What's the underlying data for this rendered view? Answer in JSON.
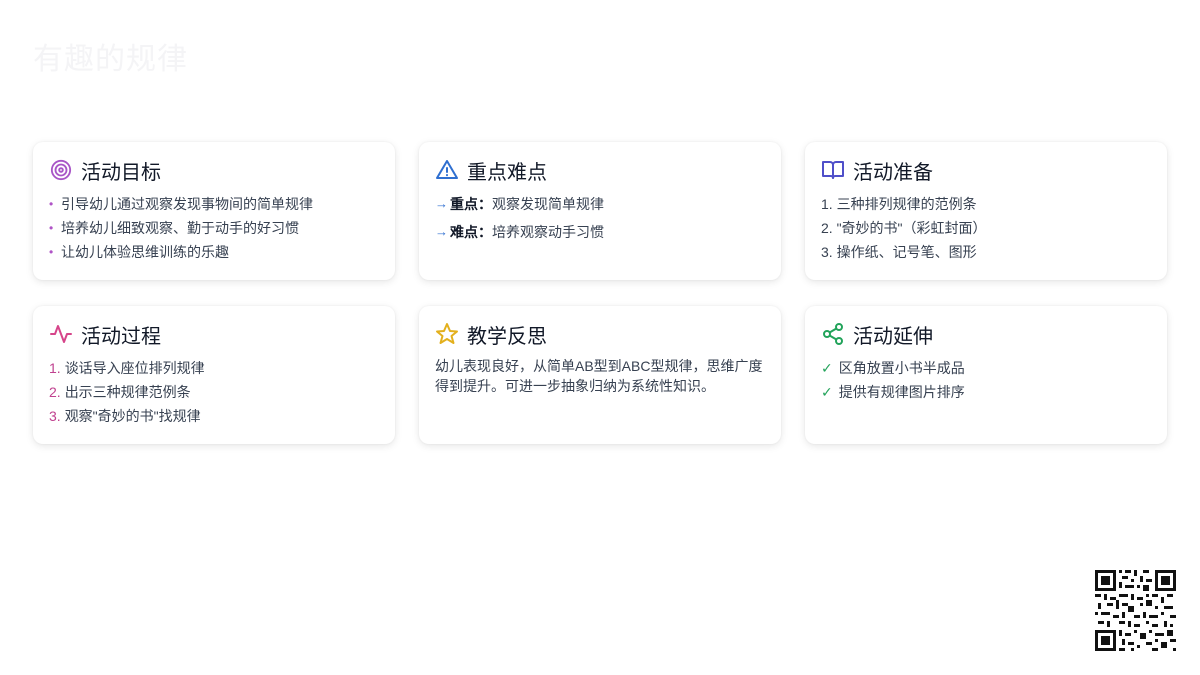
{
  "page": {
    "title": "有趣的规律"
  },
  "colors": {
    "goal_icon": "#a855c7",
    "key_icon": "#2f6fd0",
    "prep_icon": "#4f4fc9",
    "process_icon": "#d6458a",
    "reflect_icon": "#e3b01d",
    "extend_icon": "#22a35a"
  },
  "cards": {
    "goals": {
      "title": "活动目标",
      "icon": "target-icon",
      "items": [
        "引导幼儿通过观察发现事物间的简单规律",
        "培养幼儿细致观察、勤于动手的好习惯",
        "让幼儿体验思维训练的乐趣"
      ]
    },
    "key_points": {
      "title": "重点难点",
      "icon": "warning-icon",
      "items": [
        {
          "label": "重点：",
          "text": "观察发现简单规律"
        },
        {
          "label": "难点：",
          "text": "培养观察动手习惯"
        }
      ]
    },
    "preparation": {
      "title": "活动准备",
      "icon": "book-icon",
      "items": [
        "1. 三种排列规律的范例条",
        "2. \"奇妙的书\"（彩虹封面）",
        "3. 操作纸、记号笔、图形"
      ]
    },
    "process": {
      "title": "活动过程",
      "icon": "activity-icon",
      "items": [
        {
          "num": "1.",
          "text": "谈话导入座位排列规律"
        },
        {
          "num": "2.",
          "text": "出示三种规律范例条"
        },
        {
          "num": "3.",
          "text": "观察\"奇妙的书\"找规律"
        }
      ]
    },
    "reflection": {
      "title": "教学反思",
      "icon": "star-icon",
      "text": "幼儿表现良好，从简单AB型到ABC型规律，思维广度得到提升。可进一步抽象归纳为系统性知识。"
    },
    "extension": {
      "title": "活动延伸",
      "icon": "share-icon",
      "items": [
        "区角放置小书半成品",
        "提供有规律图片排序"
      ]
    }
  }
}
